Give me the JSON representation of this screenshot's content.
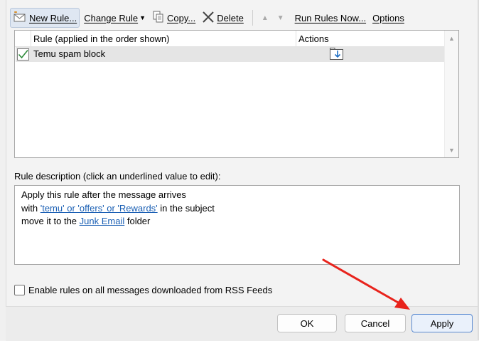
{
  "toolbar": {
    "new_rule": "New Rule...",
    "change_rule": "Change Rule",
    "copy": "Copy...",
    "delete": "Delete",
    "run_rules_now": "Run Rules Now...",
    "options": "Options",
    "icons": [
      "new-rule-icon",
      "dropdown-icon",
      "copy-icon",
      "delete-x-icon",
      "move-up-icon",
      "move-down-icon"
    ]
  },
  "rules_list": {
    "columns": [
      "Rule (applied in the order shown)",
      "Actions"
    ],
    "rows": [
      {
        "enabled": true,
        "name": "Temu spam block",
        "action_icon": "move-to-folder-icon"
      }
    ]
  },
  "description": {
    "label": "Rule description (click an underlined value to edit):",
    "line1": "Apply this rule after the message arrives",
    "line2_pre": "with ",
    "line2_link": "'temu' or 'offers' or 'Rewards'",
    "line2_post": " in the subject",
    "line3_pre": "move it to the ",
    "line3_link": "Junk Email",
    "line3_post": " folder"
  },
  "rss_checkbox": {
    "label": "Enable rules on all messages downloaded from RSS Feeds",
    "checked": false
  },
  "buttons": {
    "ok": "OK",
    "cancel": "Cancel",
    "apply": "Apply"
  },
  "colors": {
    "link": "#1a5fb4",
    "annotation_arrow": "#e8231c",
    "selected_row": "#e5e5e5"
  }
}
